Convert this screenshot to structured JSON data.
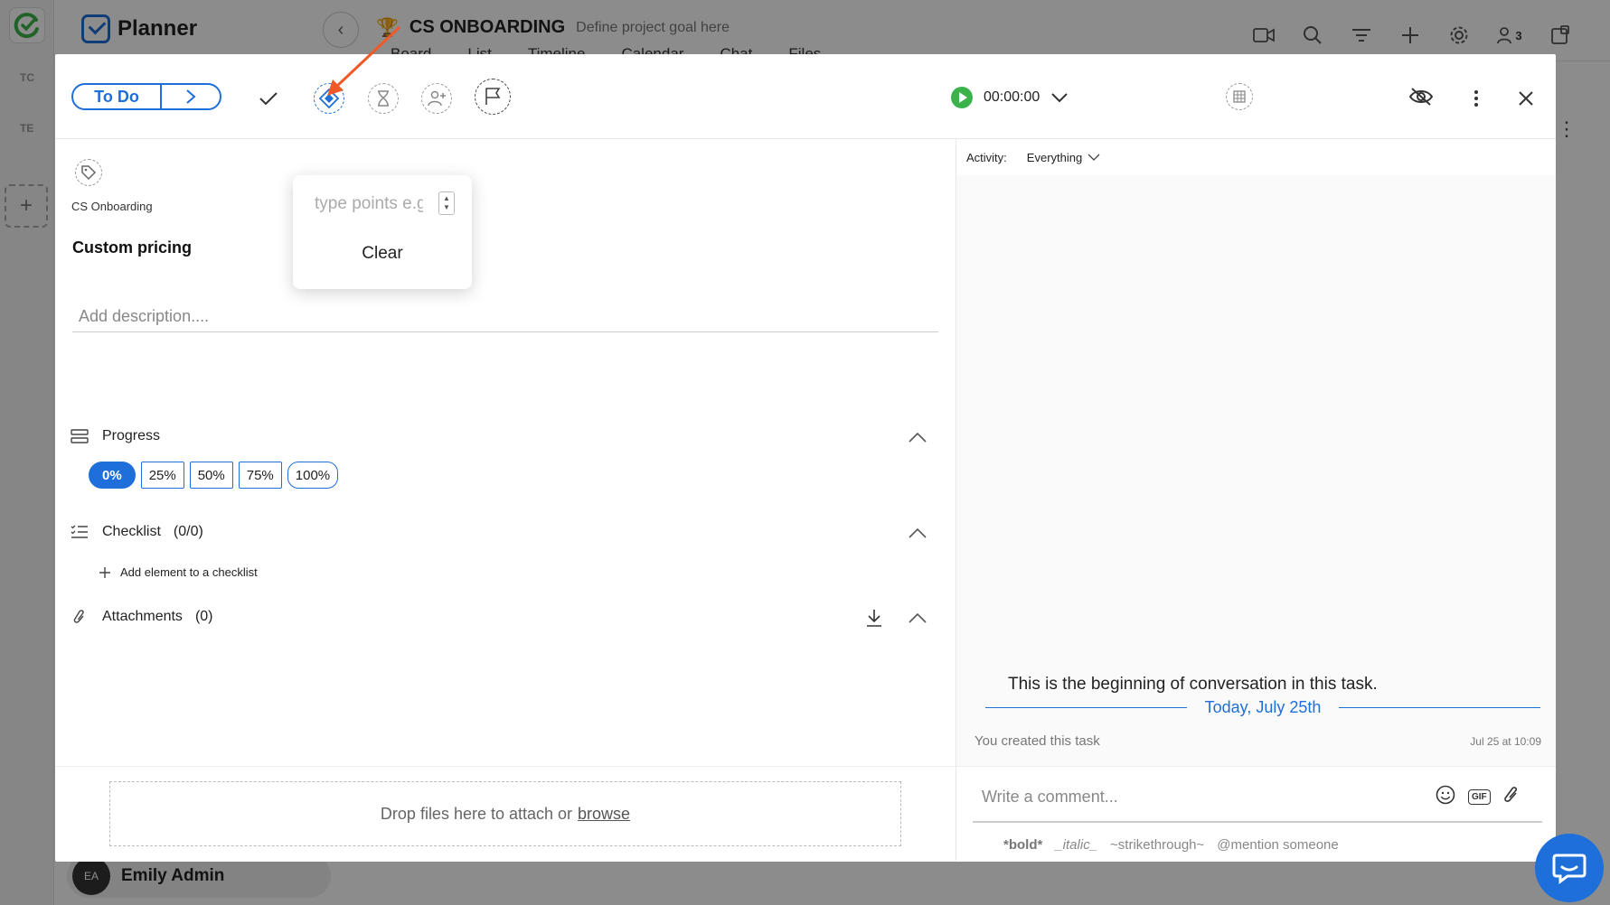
{
  "background": {
    "brand_name": "Planner",
    "project_title": "CS ONBOARDING",
    "project_goal": "Define project goal here",
    "tabs": [
      "Board",
      "List",
      "Timeline",
      "Calendar",
      "Chat",
      "Files"
    ],
    "rail_items": [
      "TC",
      "TE"
    ],
    "user": {
      "initials": "EA",
      "name": "Emily Admin"
    },
    "team_count": "3"
  },
  "task": {
    "status_label": "To Do",
    "timer": "00:00:00",
    "tag_label": "CS Onboarding",
    "title": "Custom pricing",
    "description_placeholder": "Add description....",
    "points_popover": {
      "placeholder": "type points e.g.",
      "clear_label": "Clear"
    },
    "progress": {
      "label": "Progress",
      "options": [
        "0%",
        "25%",
        "50%",
        "75%",
        "100%"
      ],
      "selected": "0%"
    },
    "checklist": {
      "label": "Checklist",
      "count": "(0/0)",
      "add_label": "Add element to a checklist"
    },
    "attachments": {
      "label": "Attachments",
      "count": "(0)"
    },
    "dropzone": {
      "text": "Drop files here to attach or",
      "link": "browse"
    }
  },
  "activity": {
    "label": "Activity:",
    "filter": "Everything",
    "conversation_start": "This is the beginning of conversation in this task.",
    "date_divider": "Today, July 25th",
    "created_text": "You created this task",
    "created_time": "Jul 25 at 10:09",
    "comment_placeholder": "Write a comment...",
    "gif_label": "GIF",
    "format_hints": {
      "bold": "*bold*",
      "italic": "_italic_",
      "strike": "~strikethrough~",
      "mention": "@mention someone"
    }
  },
  "colors": {
    "accent": "#1e6fd9",
    "play_green": "#3cb34a",
    "annotation_arrow": "#f05a28"
  }
}
